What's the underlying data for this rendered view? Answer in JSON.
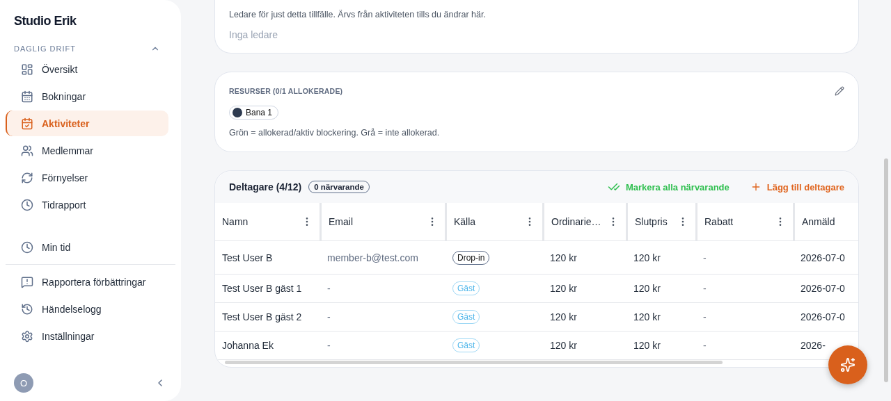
{
  "sidebar": {
    "title": "Studio Erik",
    "section": {
      "label": "DAGLIG DRIFT",
      "expanded": true
    },
    "items": [
      {
        "label": "Översikt",
        "selected": false
      },
      {
        "label": "Bokningar",
        "selected": false
      },
      {
        "label": "Aktiviteter",
        "selected": true
      },
      {
        "label": "Medlemmar",
        "selected": false
      },
      {
        "label": "Förnyelser",
        "selected": false
      },
      {
        "label": "Tidrapport",
        "selected": false
      }
    ],
    "pinned": [
      {
        "label": "Min tid",
        "selected": false
      }
    ],
    "footer_items": [
      {
        "label": "Rapportera förbättringar",
        "selected": false
      },
      {
        "label": "Händelselogg",
        "selected": false
      },
      {
        "label": "Inställningar",
        "selected": false
      }
    ],
    "avatar": "O"
  },
  "leaders_card": {
    "description": "Ledare för just detta tillfälle. Ärvs från aktiviteten tills du ändrar här.",
    "empty": "Inga ledare"
  },
  "resources_card": {
    "title": "RESURSER (0/1 ALLOKERADE)",
    "resources": [
      {
        "name": "Bana 1",
        "color": "#2d3a4f"
      }
    ],
    "legend": "Grön = allokerad/aktiv blockering. Grå = inte allokerad."
  },
  "participants": {
    "title": "Deltagare (4/12)",
    "badge": "0 närvarande",
    "mark_all": "Markera alla närvarande",
    "add": "Lägg till deltagare",
    "columns": [
      "Namn",
      "Email",
      "Källa",
      "Ordinarie…",
      "Slutpris",
      "Rabatt",
      "Anmäld"
    ],
    "rows": [
      {
        "name": "Test User B",
        "email": "member-b@test.com",
        "source": {
          "kind": "dropin",
          "label": "Drop-in"
        },
        "regular": "120 kr",
        "final": "120 kr",
        "discount": "-",
        "registered": "2026-07-0"
      },
      {
        "name": "Test User B gäst 1",
        "email": "-",
        "source": {
          "kind": "guest",
          "label": "Gäst"
        },
        "regular": "120 kr",
        "final": "120 kr",
        "discount": "-",
        "registered": "2026-07-0"
      },
      {
        "name": "Test User B gäst 2",
        "email": "-",
        "source": {
          "kind": "guest",
          "label": "Gäst"
        },
        "regular": "120 kr",
        "final": "120 kr",
        "discount": "-",
        "registered": "2026-07-0"
      },
      {
        "name": "Johanna Ek",
        "email": "-",
        "source": {
          "kind": "guest",
          "label": "Gäst"
        },
        "regular": "120 kr",
        "final": "120 kr",
        "discount": "-",
        "registered": "2026-"
      }
    ]
  }
}
